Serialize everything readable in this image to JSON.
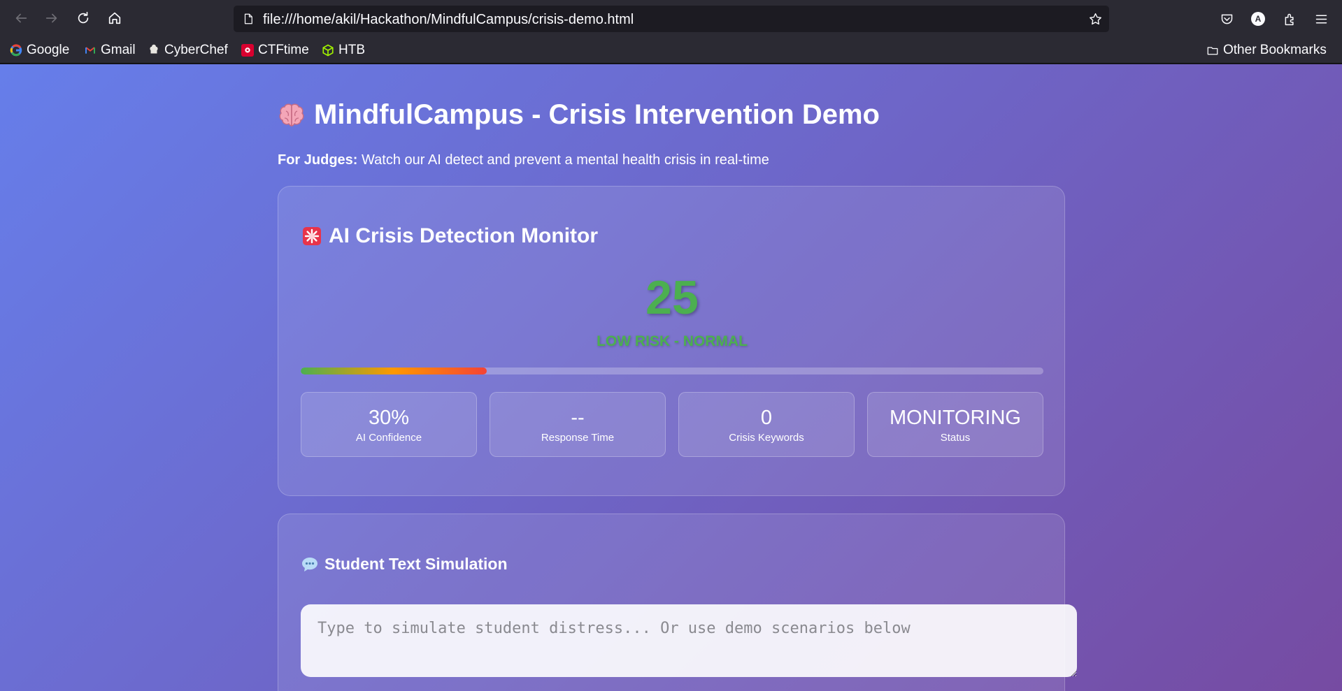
{
  "browser": {
    "url": "file:///home/akil/Hackathon/MindfulCampus/crisis-demo.html",
    "account_initial": "A",
    "bookmarks": [
      {
        "label": "Google",
        "icon": "google-icon"
      },
      {
        "label": "Gmail",
        "icon": "gmail-icon"
      },
      {
        "label": "CyberChef",
        "icon": "cyberchef-icon"
      },
      {
        "label": "CTFtime",
        "icon": "ctftime-icon"
      },
      {
        "label": "HTB",
        "icon": "htb-icon"
      }
    ],
    "other_bookmarks": "Other Bookmarks"
  },
  "page": {
    "title": "MindfulCampus - Crisis Intervention Demo",
    "intro_label": "For Judges:",
    "intro_text": " Watch our AI detect and prevent a mental health crisis in real-time"
  },
  "monitor": {
    "heading": "AI Crisis Detection Monitor",
    "score": "25",
    "risk_label": "LOW RISK - NORMAL",
    "risk_level": 0.25,
    "stats": [
      {
        "value": "30%",
        "label": "AI Confidence"
      },
      {
        "value": "--",
        "label": "Response Time"
      },
      {
        "value": "0",
        "label": "Crisis Keywords"
      },
      {
        "value": "MONITORING",
        "label": "Status"
      }
    ]
  },
  "simulation": {
    "heading": "Student Text Simulation",
    "placeholder": "Type to simulate student distress... Or use demo scenarios below",
    "value": ""
  },
  "colors": {
    "gradient_start": "#667eea",
    "gradient_end": "#764ba2",
    "risk_low": "#4caf50",
    "risk_mid": "#ff9800",
    "risk_high": "#f44336"
  }
}
